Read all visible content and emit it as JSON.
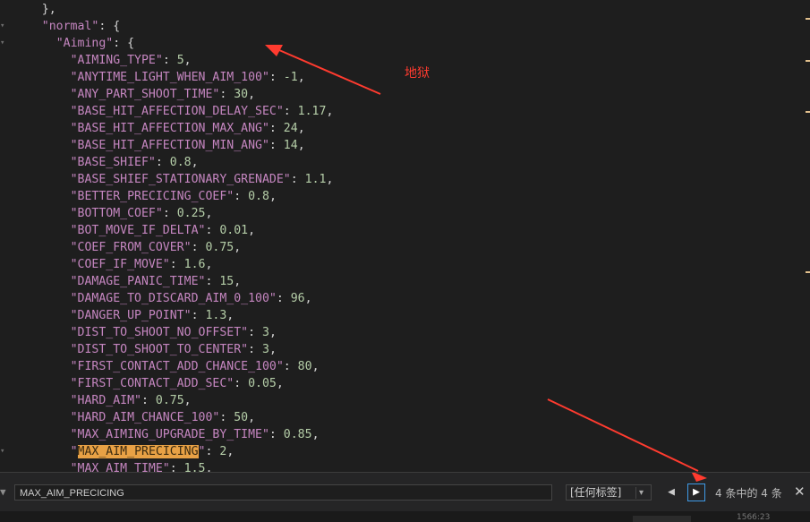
{
  "editor": {
    "lines": [
      {
        "indent": 4,
        "tokens": [
          {
            "t": "},",
            "c": "punc"
          }
        ]
      },
      {
        "indent": 4,
        "tokens": [
          {
            "t": "\"normal\"",
            "c": "key"
          },
          {
            "t": ": {",
            "c": "punc"
          }
        ]
      },
      {
        "indent": 6,
        "tokens": [
          {
            "t": "\"Aiming\"",
            "c": "key"
          },
          {
            "t": ": {",
            "c": "punc"
          }
        ]
      },
      {
        "indent": 8,
        "tokens": [
          {
            "t": "\"AIMING_TYPE\"",
            "c": "key"
          },
          {
            "t": ": ",
            "c": "punc"
          },
          {
            "t": "5",
            "c": "num"
          },
          {
            "t": ",",
            "c": "punc"
          }
        ]
      },
      {
        "indent": 8,
        "tokens": [
          {
            "t": "\"ANYTIME_LIGHT_WHEN_AIM_100\"",
            "c": "key"
          },
          {
            "t": ": ",
            "c": "punc"
          },
          {
            "t": "-1",
            "c": "num"
          },
          {
            "t": ",",
            "c": "punc"
          }
        ]
      },
      {
        "indent": 8,
        "tokens": [
          {
            "t": "\"ANY_PART_SHOOT_TIME\"",
            "c": "key"
          },
          {
            "t": ": ",
            "c": "punc"
          },
          {
            "t": "30",
            "c": "num"
          },
          {
            "t": ",",
            "c": "punc"
          }
        ]
      },
      {
        "indent": 8,
        "tokens": [
          {
            "t": "\"BASE_HIT_AFFECTION_DELAY_SEC\"",
            "c": "key"
          },
          {
            "t": ": ",
            "c": "punc"
          },
          {
            "t": "1.17",
            "c": "num"
          },
          {
            "t": ",",
            "c": "punc"
          }
        ]
      },
      {
        "indent": 8,
        "tokens": [
          {
            "t": "\"BASE_HIT_AFFECTION_MAX_ANG\"",
            "c": "key"
          },
          {
            "t": ": ",
            "c": "punc"
          },
          {
            "t": "24",
            "c": "num"
          },
          {
            "t": ",",
            "c": "punc"
          }
        ]
      },
      {
        "indent": 8,
        "tokens": [
          {
            "t": "\"BASE_HIT_AFFECTION_MIN_ANG\"",
            "c": "key"
          },
          {
            "t": ": ",
            "c": "punc"
          },
          {
            "t": "14",
            "c": "num"
          },
          {
            "t": ",",
            "c": "punc"
          }
        ]
      },
      {
        "indent": 8,
        "tokens": [
          {
            "t": "\"BASE_SHIEF\"",
            "c": "key"
          },
          {
            "t": ": ",
            "c": "punc"
          },
          {
            "t": "0.8",
            "c": "num"
          },
          {
            "t": ",",
            "c": "punc"
          }
        ]
      },
      {
        "indent": 8,
        "tokens": [
          {
            "t": "\"BASE_SHIEF_STATIONARY_GRENADE\"",
            "c": "key"
          },
          {
            "t": ": ",
            "c": "punc"
          },
          {
            "t": "1.1",
            "c": "num"
          },
          {
            "t": ",",
            "c": "punc"
          }
        ]
      },
      {
        "indent": 8,
        "tokens": [
          {
            "t": "\"BETTER_PRECICING_COEF\"",
            "c": "key"
          },
          {
            "t": ": ",
            "c": "punc"
          },
          {
            "t": "0.8",
            "c": "num"
          },
          {
            "t": ",",
            "c": "punc"
          }
        ]
      },
      {
        "indent": 8,
        "tokens": [
          {
            "t": "\"BOTTOM_COEF\"",
            "c": "key"
          },
          {
            "t": ": ",
            "c": "punc"
          },
          {
            "t": "0.25",
            "c": "num"
          },
          {
            "t": ",",
            "c": "punc"
          }
        ]
      },
      {
        "indent": 8,
        "tokens": [
          {
            "t": "\"BOT_MOVE_IF_DELTA\"",
            "c": "key"
          },
          {
            "t": ": ",
            "c": "punc"
          },
          {
            "t": "0.01",
            "c": "num"
          },
          {
            "t": ",",
            "c": "punc"
          }
        ]
      },
      {
        "indent": 8,
        "tokens": [
          {
            "t": "\"COEF_FROM_COVER\"",
            "c": "key"
          },
          {
            "t": ": ",
            "c": "punc"
          },
          {
            "t": "0.75",
            "c": "num"
          },
          {
            "t": ",",
            "c": "punc"
          }
        ]
      },
      {
        "indent": 8,
        "tokens": [
          {
            "t": "\"COEF_IF_MOVE\"",
            "c": "key"
          },
          {
            "t": ": ",
            "c": "punc"
          },
          {
            "t": "1.6",
            "c": "num"
          },
          {
            "t": ",",
            "c": "punc"
          }
        ]
      },
      {
        "indent": 8,
        "tokens": [
          {
            "t": "\"DAMAGE_PANIC_TIME\"",
            "c": "key"
          },
          {
            "t": ": ",
            "c": "punc"
          },
          {
            "t": "15",
            "c": "num"
          },
          {
            "t": ",",
            "c": "punc"
          }
        ]
      },
      {
        "indent": 8,
        "tokens": [
          {
            "t": "\"DAMAGE_TO_DISCARD_AIM_0_100\"",
            "c": "key"
          },
          {
            "t": ": ",
            "c": "punc"
          },
          {
            "t": "96",
            "c": "num"
          },
          {
            "t": ",",
            "c": "punc"
          }
        ]
      },
      {
        "indent": 8,
        "tokens": [
          {
            "t": "\"DANGER_UP_POINT\"",
            "c": "key"
          },
          {
            "t": ": ",
            "c": "punc"
          },
          {
            "t": "1.3",
            "c": "num"
          },
          {
            "t": ",",
            "c": "punc"
          }
        ]
      },
      {
        "indent": 8,
        "tokens": [
          {
            "t": "\"DIST_TO_SHOOT_NO_OFFSET\"",
            "c": "key"
          },
          {
            "t": ": ",
            "c": "punc"
          },
          {
            "t": "3",
            "c": "num"
          },
          {
            "t": ",",
            "c": "punc"
          }
        ]
      },
      {
        "indent": 8,
        "tokens": [
          {
            "t": "\"DIST_TO_SHOOT_TO_CENTER\"",
            "c": "key"
          },
          {
            "t": ": ",
            "c": "punc"
          },
          {
            "t": "3",
            "c": "num"
          },
          {
            "t": ",",
            "c": "punc"
          }
        ]
      },
      {
        "indent": 8,
        "tokens": [
          {
            "t": "\"FIRST_CONTACT_ADD_CHANCE_100\"",
            "c": "key"
          },
          {
            "t": ": ",
            "c": "punc"
          },
          {
            "t": "80",
            "c": "num"
          },
          {
            "t": ",",
            "c": "punc"
          }
        ]
      },
      {
        "indent": 8,
        "tokens": [
          {
            "t": "\"FIRST_CONTACT_ADD_SEC\"",
            "c": "key"
          },
          {
            "t": ": ",
            "c": "punc"
          },
          {
            "t": "0.05",
            "c": "num"
          },
          {
            "t": ",",
            "c": "punc"
          }
        ]
      },
      {
        "indent": 8,
        "tokens": [
          {
            "t": "\"HARD_AIM\"",
            "c": "key"
          },
          {
            "t": ": ",
            "c": "punc"
          },
          {
            "t": "0.75",
            "c": "num"
          },
          {
            "t": ",",
            "c": "punc"
          }
        ]
      },
      {
        "indent": 8,
        "tokens": [
          {
            "t": "\"HARD_AIM_CHANCE_100\"",
            "c": "key"
          },
          {
            "t": ": ",
            "c": "punc"
          },
          {
            "t": "50",
            "c": "num"
          },
          {
            "t": ",",
            "c": "punc"
          }
        ]
      },
      {
        "indent": 8,
        "tokens": [
          {
            "t": "\"MAX_AIMING_UPGRADE_BY_TIME\"",
            "c": "key"
          },
          {
            "t": ": ",
            "c": "punc"
          },
          {
            "t": "0.85",
            "c": "num"
          },
          {
            "t": ",",
            "c": "punc"
          }
        ]
      },
      {
        "indent": 8,
        "tokens": [
          {
            "t": "\"",
            "c": "key"
          },
          {
            "t": "MAX_AIM_PRECICING",
            "c": "hl"
          },
          {
            "t": "\"",
            "c": "key"
          },
          {
            "t": ": ",
            "c": "punc"
          },
          {
            "t": "2",
            "c": "num"
          },
          {
            "t": ",",
            "c": "punc"
          }
        ]
      },
      {
        "indent": 8,
        "tokens": [
          {
            "t": "\"MAX_AIM_TIME\"",
            "c": "key"
          },
          {
            "t": ": ",
            "c": "punc"
          },
          {
            "t": "1.5",
            "c": "num"
          },
          {
            "t": ",",
            "c": "punc"
          }
        ]
      }
    ]
  },
  "annotation": {
    "note": "地狱",
    "color": "#ff3b2f"
  },
  "find_bar": {
    "query": "MAX_AIM_PRECICING",
    "tag_filter": "[任何标签]",
    "result_count": "4 条中的 4 条",
    "prev_icon": "◀",
    "next_icon": "▶",
    "close_icon": "✕",
    "filter_icon": "▼"
  },
  "status_bar": {
    "position": "1566:23"
  },
  "colors": {
    "key": "#c586c0",
    "number": "#b5cea8",
    "highlight": "#e8a145",
    "background": "#1e1e1e"
  }
}
